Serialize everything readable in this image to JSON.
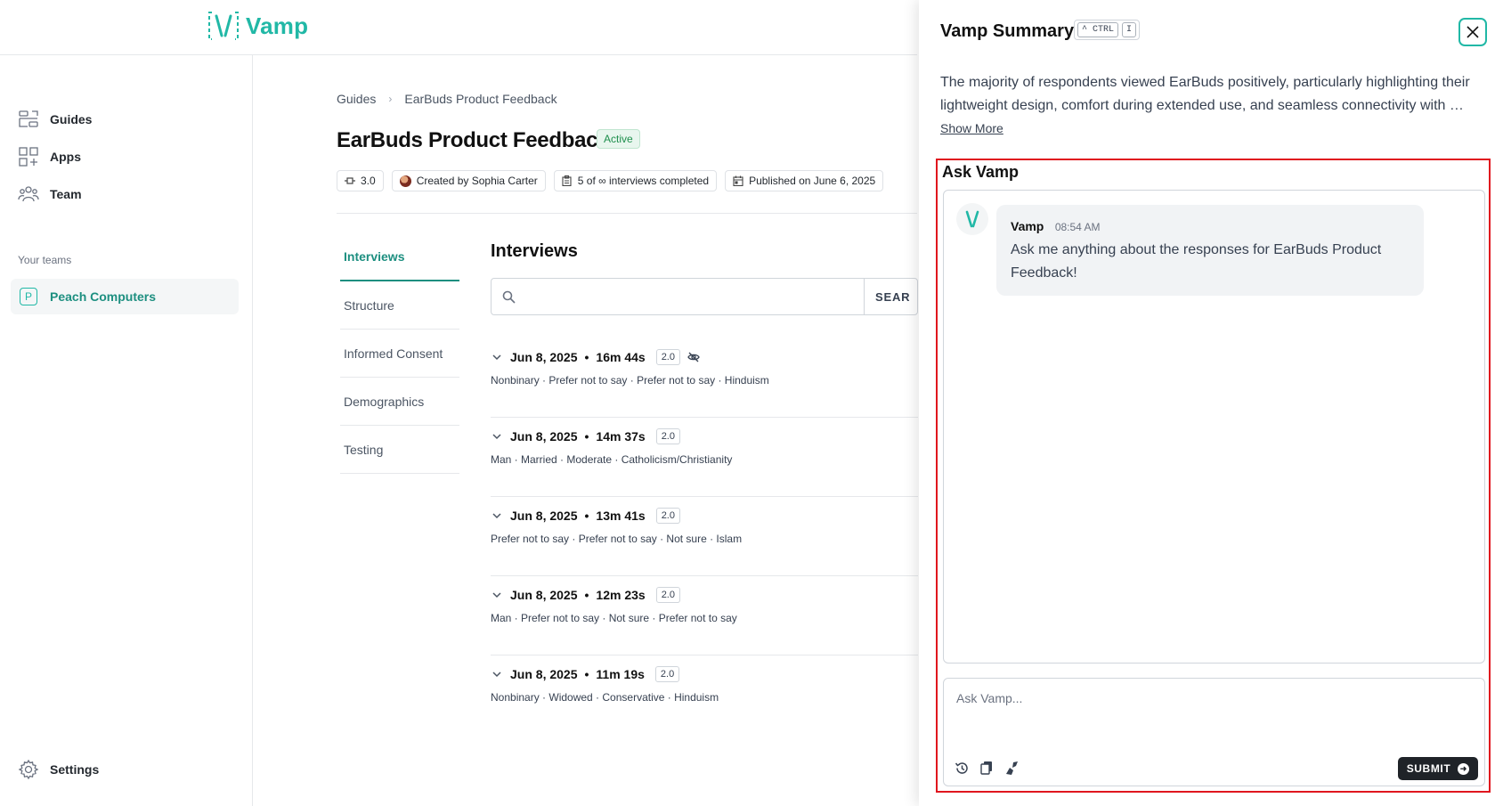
{
  "app": {
    "name": "Vamp",
    "accent": "#21b8a6"
  },
  "sidebar": {
    "items": [
      {
        "label": "Guides",
        "icon": "guides-icon"
      },
      {
        "label": "Apps",
        "icon": "apps-icon"
      },
      {
        "label": "Team",
        "icon": "team-icon"
      }
    ],
    "teams_label": "Your teams",
    "team": {
      "badge": "P",
      "name": "Peach Computers"
    },
    "settings_label": "Settings"
  },
  "breadcrumb": {
    "root": "Guides",
    "current": "EarBuds Product Feedback"
  },
  "guide": {
    "title": "EarBuds Product Feedback",
    "status": "Active",
    "version": "3.0",
    "created_by": "Created by Sophia Carter",
    "completed": "5 of ∞ interviews completed",
    "published": "Published on June 6, 2025"
  },
  "tabs": [
    "Interviews",
    "Structure",
    "Informed Consent",
    "Demographics",
    "Testing"
  ],
  "interviews": {
    "title": "Interviews",
    "search_button": "SEAR",
    "rows": [
      {
        "date": "Jun 8, 2025",
        "duration": "16m 44s",
        "version": "2.0",
        "hidden": true,
        "tags": "Nonbinary  ·  Prefer not to say  ·  Prefer not to say  ·  Hinduism"
      },
      {
        "date": "Jun 8, 2025",
        "duration": "14m 37s",
        "version": "2.0",
        "hidden": false,
        "tags": "Man  ·  Married  ·  Moderate  ·  Catholicism/Christianity"
      },
      {
        "date": "Jun 8, 2025",
        "duration": "13m 41s",
        "version": "2.0",
        "hidden": false,
        "tags": "Prefer not to say  ·  Prefer not to say  ·  Not sure  ·  Islam"
      },
      {
        "date": "Jun 8, 2025",
        "duration": "12m 23s",
        "version": "2.0",
        "hidden": false,
        "tags": "Man  ·  Prefer not to say  ·  Not sure  ·  Prefer not to say"
      },
      {
        "date": "Jun 8, 2025",
        "duration": "11m 19s",
        "version": "2.0",
        "hidden": false,
        "tags": "Nonbinary  ·  Widowed  ·  Conservative  ·  Hinduism"
      }
    ]
  },
  "panel": {
    "title": "Vamp Summary",
    "shortcut_ctrl": "^ CTRL",
    "shortcut_key": "I",
    "summary": "The majority of respondents viewed EarBuds positively, particularly highlighting their lightweight design, comfort during extended use, and seamless connectivity with …",
    "show_more": "Show More",
    "ask_title": "Ask Vamp",
    "message": {
      "sender": "Vamp",
      "time": "08:54 AM",
      "text": "Ask me anything about the responses for EarBuds Product Feedback!"
    },
    "input_placeholder": "Ask Vamp...",
    "submit_label": "SUBMIT"
  }
}
